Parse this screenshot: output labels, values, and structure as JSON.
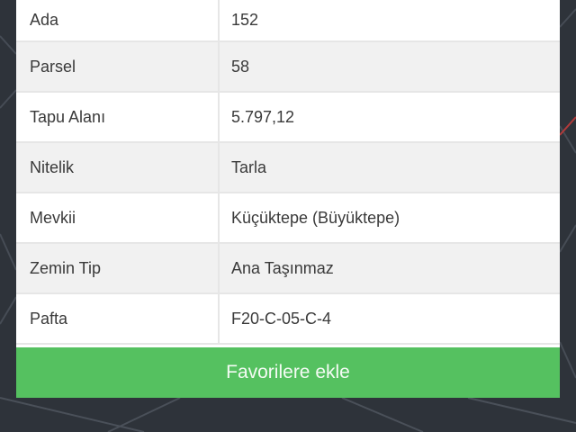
{
  "parcel_info": {
    "rows": [
      {
        "key": "Ada",
        "value": "152"
      },
      {
        "key": "Parsel",
        "value": "58"
      },
      {
        "key": "Tapu Alanı",
        "value": "5.797,12"
      },
      {
        "key": "Nitelik",
        "value": "Tarla"
      },
      {
        "key": "Mevkii",
        "value": "Küçüktepe (Büyüktepe)"
      },
      {
        "key": "Zemin Tip",
        "value": "Ana Taşınmaz"
      },
      {
        "key": "Pafta",
        "value": "F20-C-05-C-4"
      }
    ]
  },
  "actions": {
    "favorite_label": "Favorilere ekle"
  },
  "colors": {
    "button_green": "#55c160",
    "row_alt": "#f1f1f1",
    "backdrop": "#2b2f36"
  }
}
